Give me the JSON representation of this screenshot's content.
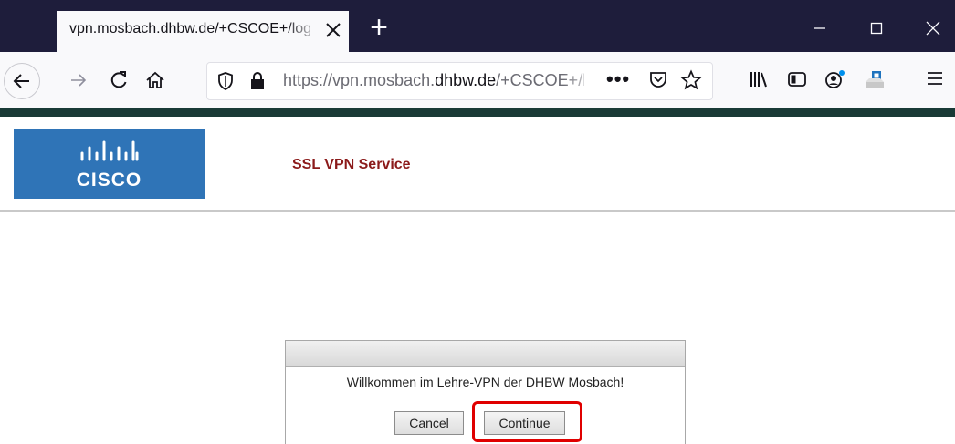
{
  "browser": {
    "tab_title": "vpn.mosbach.dhbw.de/+CSCOE+/logon.html",
    "new_tab_label": "+",
    "url_prefix": "https://vpn.mosbach.",
    "url_domain": "dhbw.de",
    "url_suffix": "/+CSCOE+/logon.html",
    "url_more": "•••",
    "window_colors": {
      "titlebar": "#1e1d3b",
      "toolbar": "#f9f9fb",
      "accent_bar": "#193a36"
    }
  },
  "icons": {
    "back": "arrow-left-icon",
    "forward": "arrow-right-icon",
    "reload": "reload-icon",
    "home": "home-icon",
    "tracking": "shield-icon",
    "lock": "lock-icon",
    "pocket": "pocket-icon",
    "bookmark": "star-icon",
    "library": "library-icon",
    "sidebar": "sidebar-icon",
    "account": "account-icon",
    "extension": "extension-icon",
    "menu": "hamburger-icon"
  },
  "page": {
    "logo_text": "CISCO",
    "logo_color": "#2f74b7",
    "service_title": "SSL VPN Service",
    "service_title_color": "#8b1a1a"
  },
  "dialog": {
    "message": "Willkommen im Lehre-VPN der DHBW Mosbach!",
    "cancel_label": "Cancel",
    "continue_label": "Continue",
    "highlight_color": "#e00000"
  }
}
